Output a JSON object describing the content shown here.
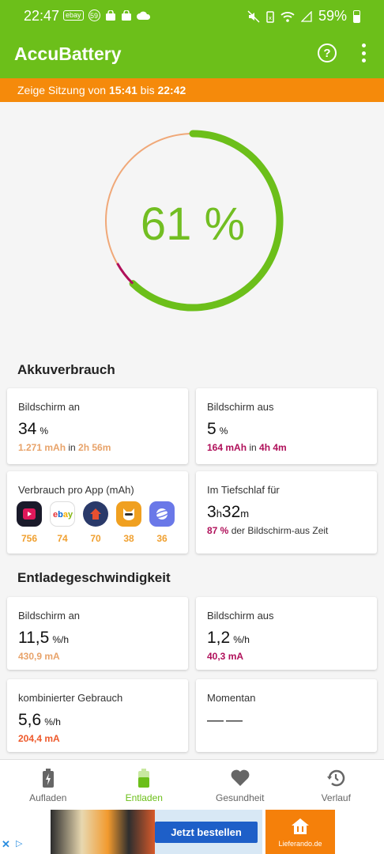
{
  "status": {
    "time": "22:47",
    "battery_percent": "59%",
    "notif_badge1": "ebay",
    "notif_badge2": "59"
  },
  "app": {
    "title": "AccuBattery"
  },
  "session": {
    "prefix": "Zeige Sitzung von ",
    "from": "15:41",
    "mid": " bis ",
    "to": "22:42"
  },
  "gauge": {
    "value_text": "61 %",
    "percent": 61
  },
  "akku": {
    "title": "Akkuverbrauch",
    "screen_on": {
      "label": "Bildschirm an",
      "value": "34",
      "unit": "%",
      "mah": "1.271 mAh",
      "in": " in ",
      "time": "2h 56m"
    },
    "screen_off": {
      "label": "Bildschirm aus",
      "value": "5",
      "unit": "%",
      "mah": "164 mAh",
      "in": " in ",
      "time": "4h 4m"
    },
    "per_app": {
      "label": "Verbrauch pro App (mAh)",
      "apps": [
        {
          "icon": "youtube-icon",
          "value": "756"
        },
        {
          "icon": "ebay-icon",
          "value": "74"
        },
        {
          "icon": "home-icon",
          "value": "70"
        },
        {
          "icon": "cat-icon",
          "value": "38"
        },
        {
          "icon": "browser-icon",
          "value": "36"
        }
      ]
    },
    "deep_sleep": {
      "label": "Im Tiefschlaf für",
      "h": "3",
      "h_unit": "h",
      "m": "32",
      "m_unit": "m",
      "pct": "87 %",
      "rest": " der Bildschirm-aus Zeit"
    }
  },
  "discharge": {
    "title": "Entladegeschwindigkeit",
    "screen_on": {
      "label": "Bildschirm an",
      "value": "11,5",
      "unit": "%/h",
      "ma": "430,9 mA"
    },
    "screen_off": {
      "label": "Bildschirm aus",
      "value": "1,2",
      "unit": "%/h",
      "ma": "40,3 mA"
    },
    "combined": {
      "label": "kombinierter Gebrauch",
      "value": "5,6",
      "unit": "%/h",
      "ma": "204,4 mA"
    },
    "momentary": {
      "label": "Momentan",
      "value": "——"
    }
  },
  "nav": [
    {
      "label": "Aufladen",
      "icon": "battery-charging-icon"
    },
    {
      "label": "Entladen",
      "icon": "battery-discharging-icon"
    },
    {
      "label": "Gesundheit",
      "icon": "heart-icon"
    },
    {
      "label": "Verlauf",
      "icon": "history-icon"
    }
  ],
  "ad": {
    "cta": "Jetzt bestellen",
    "brand": "Lieferando.de"
  },
  "colors": {
    "primary": "#6cbf1a",
    "session_bar": "#f58a0b",
    "screen_on": "#f0a060",
    "screen_off": "#b0105a"
  }
}
